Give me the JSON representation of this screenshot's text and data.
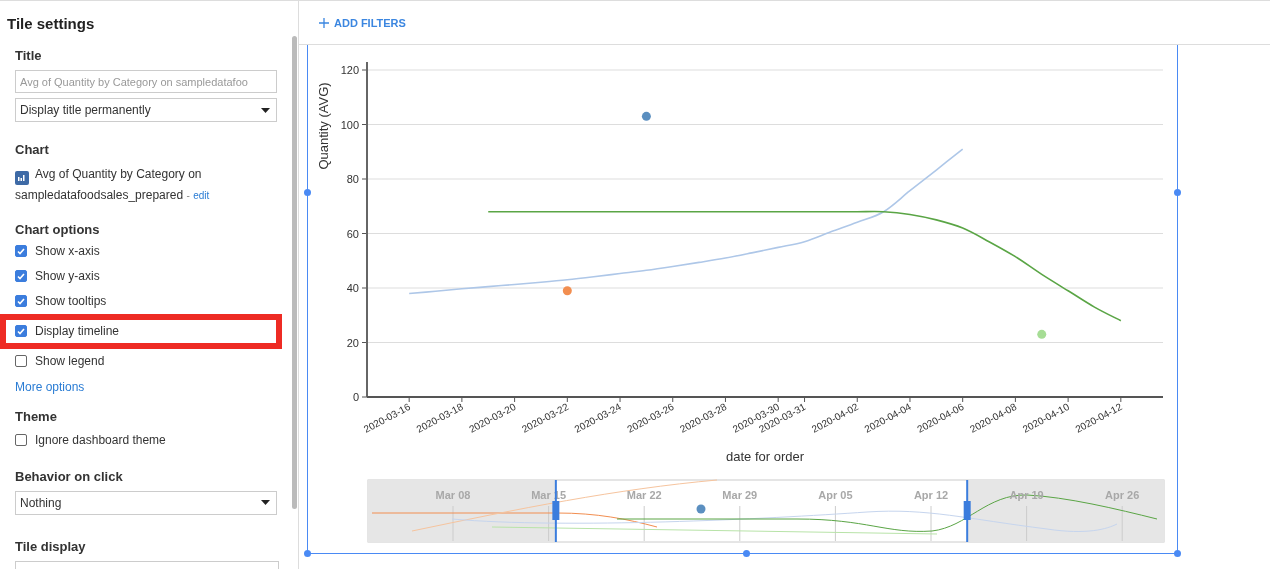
{
  "settings": {
    "heading": "Tile settings",
    "title_section": {
      "label": "Title",
      "field": {
        "placeholder": "Avg of Quantity by Category on sampledatafoo"
      },
      "display_select": {
        "value": "Display title permanently"
      }
    },
    "chart_section": {
      "label": "Chart",
      "chart_name": "Avg of Quantity by Category on sampledatafoodsales_prepared",
      "separator": "-",
      "edit_link": "edit"
    },
    "chart_options": {
      "label": "Chart options",
      "options": [
        {
          "label": "Show x-axis",
          "checked": true,
          "highlighted": false
        },
        {
          "label": "Show y-axis",
          "checked": true,
          "highlighted": false
        },
        {
          "label": "Show tooltips",
          "checked": true,
          "highlighted": false
        },
        {
          "label": "Display timeline",
          "checked": true,
          "highlighted": true
        },
        {
          "label": "Show legend",
          "checked": false,
          "highlighted": false
        }
      ],
      "more_link": "More options"
    },
    "theme": {
      "label": "Theme",
      "option": {
        "label": "Ignore dashboard theme",
        "checked": false
      }
    },
    "behavior": {
      "label": "Behavior on click",
      "select": {
        "value": "Nothing"
      }
    },
    "tile_display": {
      "label": "Tile display"
    }
  },
  "toolbar": {
    "add_filters": "ADD FILTERS"
  },
  "chart": {
    "chart_data": {
      "type": "line",
      "xlabel": "date for order",
      "ylabel": "Quantity (AVG)",
      "categories": [
        "2020-03-16",
        null,
        "2020-03-18",
        null,
        "2020-03-20",
        null,
        "2020-03-22",
        null,
        "2020-03-24",
        null,
        "2020-03-26",
        null,
        "2020-03-28",
        null,
        "2020-03-30",
        "2020-03-31",
        null,
        "2020-04-02",
        null,
        "2020-04-04",
        null,
        "2020-04-06",
        null,
        "2020-04-08",
        null,
        "2020-04-10",
        null,
        "2020-04-12"
      ],
      "series": [
        {
          "color": "#aec7e8",
          "values": [
            38,
            38.8,
            39.7,
            40.5,
            41.3,
            42.1,
            43,
            44.1,
            45.3,
            46.5,
            47.9,
            49.4,
            51,
            52.9,
            54.9,
            57,
            60.6,
            64.1,
            68,
            75.7,
            83.3,
            91,
            null,
            null,
            null,
            null,
            null,
            null
          ]
        },
        {
          "color": "#5aa545",
          "values": [
            null,
            null,
            null,
            68,
            68,
            68,
            68,
            68,
            68,
            68,
            68,
            68,
            68,
            68,
            68,
            68,
            68,
            68,
            68,
            67,
            65,
            62,
            57,
            51.5,
            45,
            39,
            33,
            28
          ]
        },
        {
          "color": "#5b8fc0",
          "marker": true,
          "values": [
            null,
            null,
            null,
            null,
            null,
            null,
            null,
            null,
            null,
            103,
            null,
            null,
            null,
            null,
            null,
            null,
            null,
            null,
            null,
            null,
            null,
            null,
            null,
            null,
            null,
            null,
            null,
            null
          ]
        },
        {
          "color": "#f28e50",
          "marker": true,
          "values": [
            null,
            null,
            null,
            null,
            null,
            null,
            39,
            null,
            null,
            null,
            null,
            null,
            null,
            null,
            null,
            null,
            null,
            null,
            null,
            null,
            null,
            null,
            null,
            null,
            null,
            null,
            null,
            null
          ]
        },
        {
          "color": "#a6dd95",
          "marker": true,
          "values": [
            null,
            null,
            null,
            null,
            null,
            null,
            null,
            null,
            null,
            null,
            null,
            null,
            null,
            null,
            null,
            null,
            null,
            null,
            null,
            null,
            null,
            null,
            null,
            null,
            23,
            null,
            null,
            null
          ]
        }
      ],
      "ylim": [
        0,
        120
      ],
      "grid": true,
      "yticks": [
        0,
        20,
        40,
        60,
        80,
        100,
        120
      ]
    }
  },
  "timeline": {
    "labels": [
      "Mar 08",
      "Mar 15",
      "Mar 22",
      "Mar 29",
      "Apr 05",
      "Apr 12",
      "Apr 19",
      "Apr 26"
    ],
    "start_handle": {
      "level": 0.236
    },
    "end_handle": {
      "level": 0.754
    }
  }
}
